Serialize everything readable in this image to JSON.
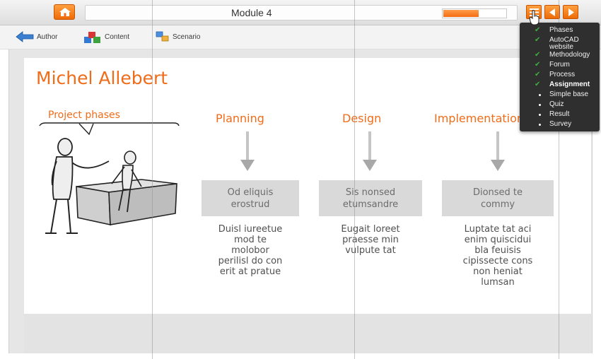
{
  "header": {
    "module_title": "Module 4",
    "progress_percent": 55,
    "home_icon": "home-icon",
    "menu_icon": "list-menu-icon",
    "prev_icon": "arrow-left-icon",
    "next_icon": "arrow-right-icon",
    "accent_color": "#ef6c1a"
  },
  "toolbar": {
    "items": [
      {
        "label": "Author",
        "icon": "author-arrow-icon"
      },
      {
        "label": "Content",
        "icon": "content-blocks-icon"
      },
      {
        "label": "Scenario",
        "icon": "scenario-icon"
      }
    ]
  },
  "slide": {
    "title": "Michel Allebert",
    "bubble_label": "Project phases",
    "columns": [
      {
        "heading": "Planning",
        "box": [
          "Od eliquis",
          "erostrud"
        ],
        "text": [
          "Duisl iureetue",
          "mod te",
          "molobor",
          "perilisl do con",
          "erit at pratue"
        ]
      },
      {
        "heading": "Design",
        "box": [
          "Sis nonsed",
          "etumsandre"
        ],
        "text": [
          "Eugait loreet",
          "praesse min",
          "vulpute tat"
        ]
      },
      {
        "heading": "Implementation",
        "box": [
          "Dionsed te",
          "commy"
        ],
        "text": [
          "Luptate tat aci",
          "enim quiscidui",
          "bla feuisis",
          "cipissecte cons",
          "non heniat",
          "lumsan"
        ]
      }
    ]
  },
  "menu": {
    "items": [
      {
        "label": "Phases",
        "marker": "check"
      },
      {
        "label": "AutoCAD website",
        "marker": "check"
      },
      {
        "label": "Methodology",
        "marker": "check"
      },
      {
        "label": "Forum",
        "marker": "check"
      },
      {
        "label": "Process",
        "marker": "check"
      },
      {
        "label": "Assignment",
        "marker": "check",
        "active": true
      },
      {
        "label": "Simple base",
        "marker": "bullet"
      },
      {
        "label": "Quiz",
        "marker": "bullet"
      },
      {
        "label": "Result",
        "marker": "bullet"
      },
      {
        "label": "Survey",
        "marker": "bullet"
      }
    ]
  }
}
